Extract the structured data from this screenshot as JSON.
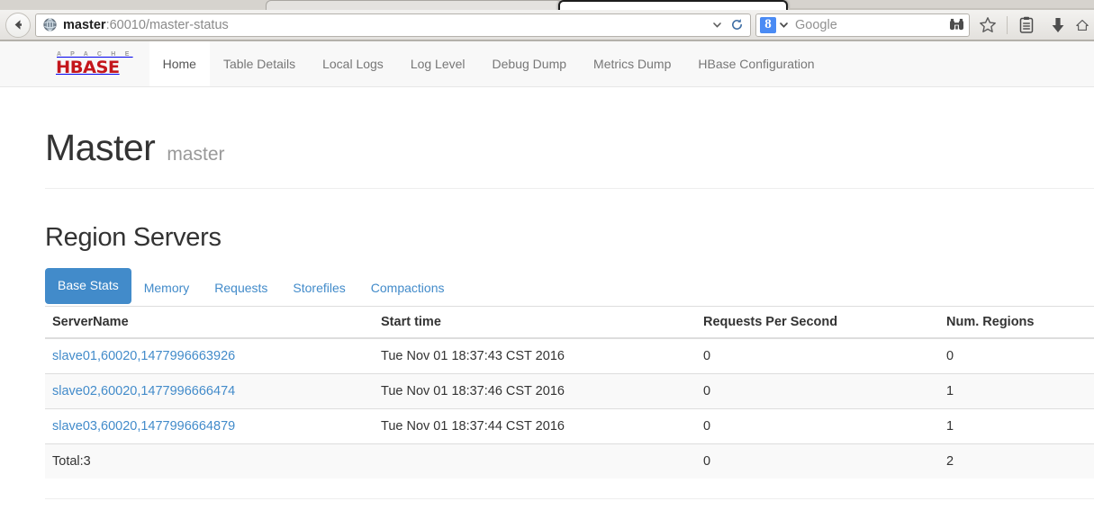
{
  "browser": {
    "back_icon": "back-arrow-icon",
    "favicon": "globe-favicon-icon",
    "url_host": "master",
    "url_path": ":60010/master-status",
    "url_full": "master:60010/master-status",
    "dropdown_icon": "chevron-down-icon",
    "reload_icon": "reload-icon",
    "search_engine_logo": "8",
    "search_placeholder": "Google",
    "search_icon": "binoculars-icon",
    "bookmark_icon": "star-icon",
    "reader_icon": "clipboard-icon",
    "download_icon": "download-arrow-icon",
    "home_icon": "home-icon"
  },
  "navbar": {
    "brand_top": "A P A C H E",
    "brand_main": "HBASE",
    "items": [
      {
        "label": "Home",
        "active": true
      },
      {
        "label": "Table Details",
        "active": false
      },
      {
        "label": "Local Logs",
        "active": false
      },
      {
        "label": "Log Level",
        "active": false
      },
      {
        "label": "Debug Dump",
        "active": false
      },
      {
        "label": "Metrics Dump",
        "active": false
      },
      {
        "label": "HBase Configuration",
        "active": false
      }
    ]
  },
  "page": {
    "title": "Master",
    "subtitle": "master",
    "section_title": "Region Servers"
  },
  "tabs": [
    {
      "label": "Base Stats",
      "active": true
    },
    {
      "label": "Memory",
      "active": false
    },
    {
      "label": "Requests",
      "active": false
    },
    {
      "label": "Storefiles",
      "active": false
    },
    {
      "label": "Compactions",
      "active": false
    }
  ],
  "table": {
    "headers": [
      "ServerName",
      "Start time",
      "Requests Per Second",
      "Num. Regions"
    ],
    "rows": [
      {
        "server": "slave01,60020,1477996663926",
        "start": "Tue Nov 01 18:37:43 CST 2016",
        "rps": "0",
        "regions": "0",
        "is_link": true
      },
      {
        "server": "slave02,60020,1477996666474",
        "start": "Tue Nov 01 18:37:46 CST 2016",
        "rps": "0",
        "regions": "1",
        "is_link": true
      },
      {
        "server": "slave03,60020,1477996664879",
        "start": "Tue Nov 01 18:37:44 CST 2016",
        "rps": "0",
        "regions": "1",
        "is_link": true
      },
      {
        "server": "Total:3",
        "start": "",
        "rps": "0",
        "regions": "2",
        "is_link": false
      }
    ]
  },
  "colors": {
    "accent_blue": "#428bca",
    "hbase_red": "#c4161c",
    "navbar_bg": "#f8f8f8",
    "stripe": "#f9f9f9"
  }
}
